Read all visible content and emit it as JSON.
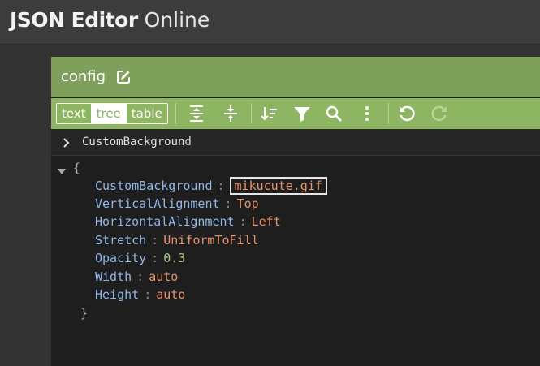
{
  "app": {
    "title_bold": "JSON Editor",
    "title_light": "Online"
  },
  "document": {
    "name": "config"
  },
  "toolbar": {
    "modes": [
      {
        "label": "text",
        "active": false
      },
      {
        "label": "tree",
        "active": true
      },
      {
        "label": "table",
        "active": false
      }
    ],
    "buttons": [
      "expand-all-icon",
      "collapse-all-icon",
      "sort-icon",
      "filter-icon",
      "search-icon",
      "more-icon",
      "undo-icon",
      "redo-icon"
    ]
  },
  "path": {
    "label": "CustomBackground"
  },
  "tree": {
    "open_brace": "{",
    "close_brace": "}",
    "colon": ":",
    "entries": [
      {
        "key": "CustomBackground",
        "value": "mikucute.gif",
        "type": "string",
        "selected": true
      },
      {
        "key": "VerticalAlignment",
        "value": "Top",
        "type": "string"
      },
      {
        "key": "HorizontalAlignment",
        "value": "Left",
        "type": "string"
      },
      {
        "key": "Stretch",
        "value": "UniformToFill",
        "type": "string"
      },
      {
        "key": "Opacity",
        "value": "0.3",
        "type": "number"
      },
      {
        "key": "Width",
        "value": "auto",
        "type": "string"
      },
      {
        "key": "Height",
        "value": "auto",
        "type": "string"
      }
    ]
  },
  "colors": {
    "header_bg": "#3c3c3c",
    "doc_bar": "#7ea05a",
    "toolbar": "#8db562",
    "key": "#8fb6e6",
    "string": "#e8916a",
    "number": "#a3c98a"
  }
}
